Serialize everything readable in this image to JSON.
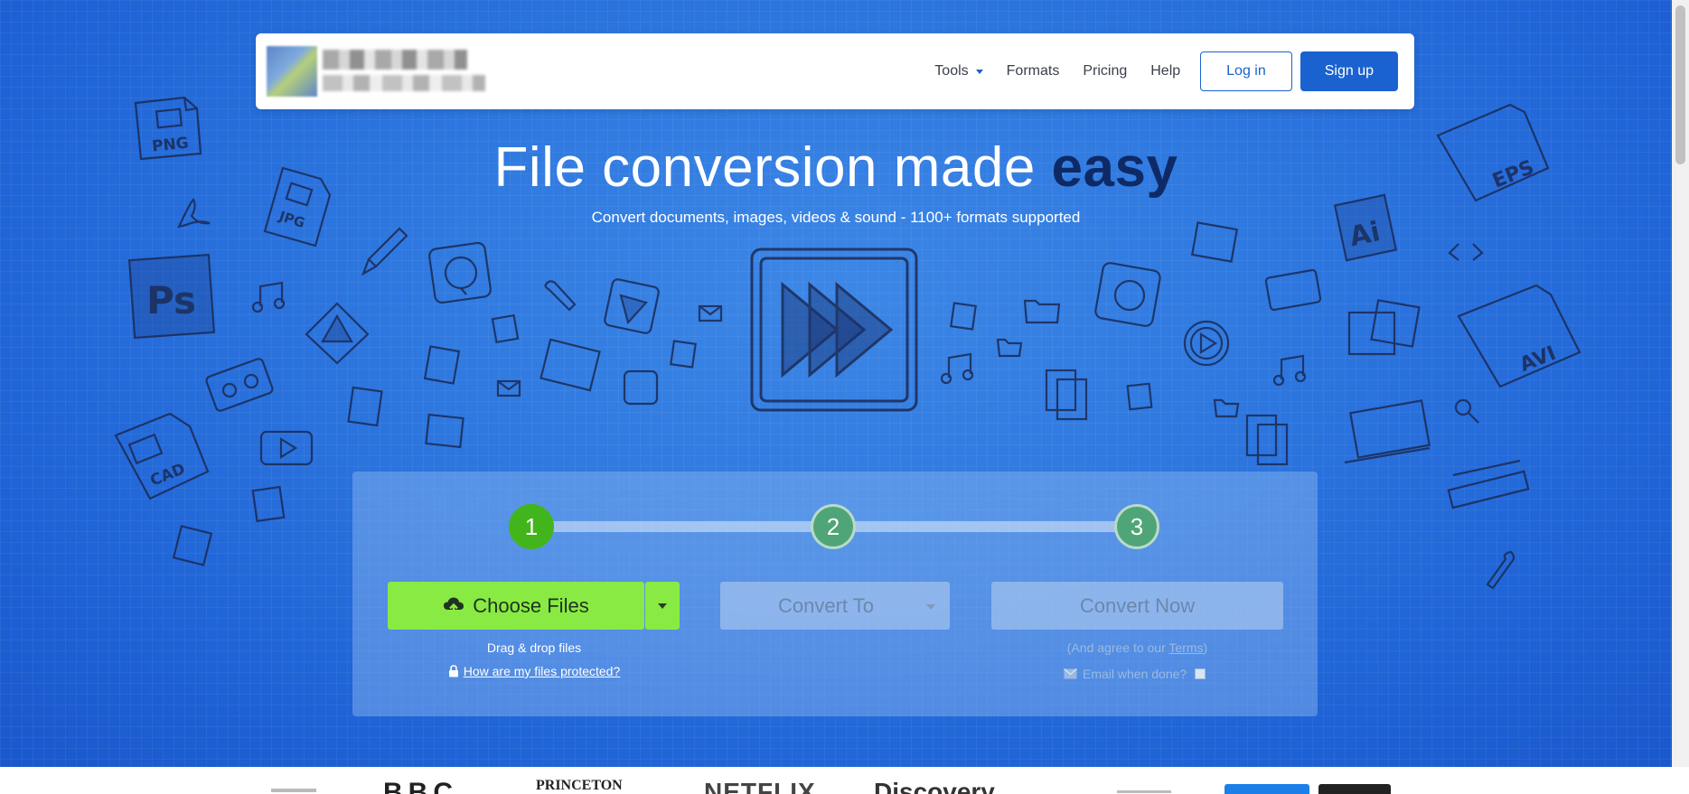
{
  "nav": {
    "items": [
      {
        "label": "Tools",
        "has_dropdown": true
      },
      {
        "label": "Formats"
      },
      {
        "label": "Pricing"
      },
      {
        "label": "Help"
      }
    ],
    "login_label": "Log in",
    "signup_label": "Sign up"
  },
  "hero": {
    "headline_main": "File conversion made ",
    "headline_emphasis": "easy",
    "subheadline": "Convert documents, images, videos & sound - 1100+ formats supported"
  },
  "steps": [
    "1",
    "2",
    "3"
  ],
  "converter": {
    "choose_files_label": "Choose Files",
    "convert_to_label": "Convert To",
    "convert_now_label": "Convert Now",
    "drag_drop_text": "Drag & drop files",
    "protection_link": "How are my files protected?",
    "agree_prefix": "(And agree to our ",
    "terms_link": "Terms",
    "agree_suffix": ")",
    "email_label": "Email when done?",
    "email_checked": false
  },
  "doodle_labels": {
    "png": "PNG",
    "jpg": "JPG",
    "ps": "Ps",
    "cad": "CAD",
    "eps": "EPS",
    "ai": "Ai",
    "avi": "AVI"
  },
  "brands": [
    "BBC",
    "PRINCETON",
    "NETFLIX",
    "Discovery"
  ],
  "colors": {
    "brand_blue": "#1a62d0",
    "choose_green": "#88ea43",
    "step_active": "#43b51c",
    "step_inactive": "#4fa577",
    "headline_emphasis": "#0e2a66"
  }
}
